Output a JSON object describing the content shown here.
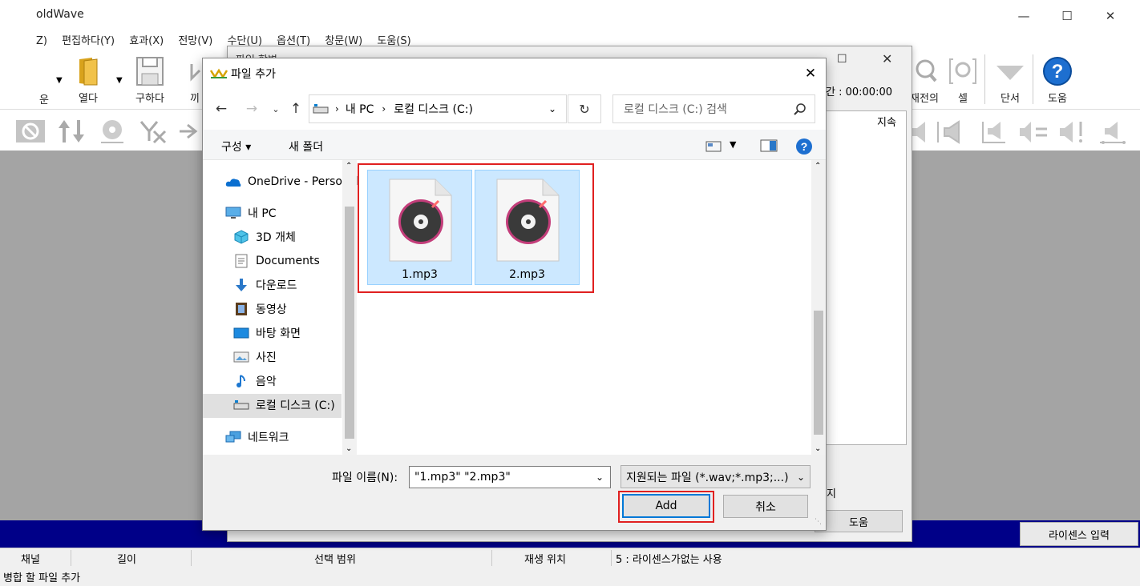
{
  "app": {
    "title": "oldWave",
    "menu": [
      "Z)",
      "편집하다(Y)",
      "효과(X)",
      "전망(V)",
      "수단(U)",
      "옵션(T)",
      "창문(W)",
      "도움(S)"
    ],
    "toolbar_left": [
      {
        "label": "운",
        "icon": "partial-icon"
      },
      {
        "label": "열다",
        "icon": "folder-open-icon"
      },
      {
        "label": "구하다",
        "icon": "save-icon"
      },
      {
        "label": "끼",
        "icon": "partial-icon"
      }
    ],
    "toolbar_right": [
      {
        "label": "재전의",
        "icon": "zoom-icon"
      },
      {
        "label": "셀",
        "icon": "select-icon"
      },
      {
        "label": "단서",
        "icon": "marker-icon"
      },
      {
        "label": "도움",
        "icon": "help-icon"
      }
    ],
    "duration_text": "간 : 00:00:00",
    "license_button": "라이센스 입력",
    "statusbar": {
      "channel": "채널",
      "length": "길이",
      "selection": "선택 범위",
      "play_position": "재생 위치",
      "license_status": "5 : 라이센스가없는 사용"
    },
    "status_line": "병합 할 파일 추가"
  },
  "merge_dialog": {
    "title": "파일 합병",
    "column_label": "지속",
    "partial_label": "지",
    "help_button": "도움"
  },
  "open_dialog": {
    "title": "파일 추가",
    "breadcrumb": [
      "내 PC",
      "로컬 디스크 (C:)"
    ],
    "search_placeholder": "로컬 디스크 (C:) 검색",
    "organize_label": "구성 ▾",
    "new_folder_label": "새 폴더",
    "nav_items": [
      {
        "label": "OneDrive - Personal",
        "icon": "onedrive-icon"
      },
      {
        "label": "내 PC",
        "icon": "pc-icon"
      },
      {
        "label": "3D 개체",
        "icon": "3d-objects-icon"
      },
      {
        "label": "Documents",
        "icon": "documents-icon"
      },
      {
        "label": "다운로드",
        "icon": "download-icon"
      },
      {
        "label": "동영상",
        "icon": "video-icon"
      },
      {
        "label": "바탕 화면",
        "icon": "desktop-icon"
      },
      {
        "label": "사진",
        "icon": "pictures-icon"
      },
      {
        "label": "음악",
        "icon": "music-icon"
      },
      {
        "label": "로컬 디스크 (C:)",
        "icon": "drive-icon"
      },
      {
        "label": "네트워크",
        "icon": "network-icon"
      }
    ],
    "files": [
      {
        "name": "1.mp3",
        "icon": "mp3-file-icon",
        "selected": true
      },
      {
        "name": "2.mp3",
        "icon": "mp3-file-icon",
        "selected": true
      }
    ],
    "filename_label": "파일 이름(N):",
    "filename_value": "\"1.mp3\" \"2.mp3\"",
    "filetype_value": "지원되는 파일 (*.wav;*.mp3;...)",
    "add_button": "Add",
    "cancel_button": "취소"
  },
  "colors": {
    "accent": "#0078d7",
    "highlight_box": "#e02020",
    "progress_band": "#000088",
    "workspace": "#a4a4a4",
    "selected_tile": "#cce8ff"
  }
}
